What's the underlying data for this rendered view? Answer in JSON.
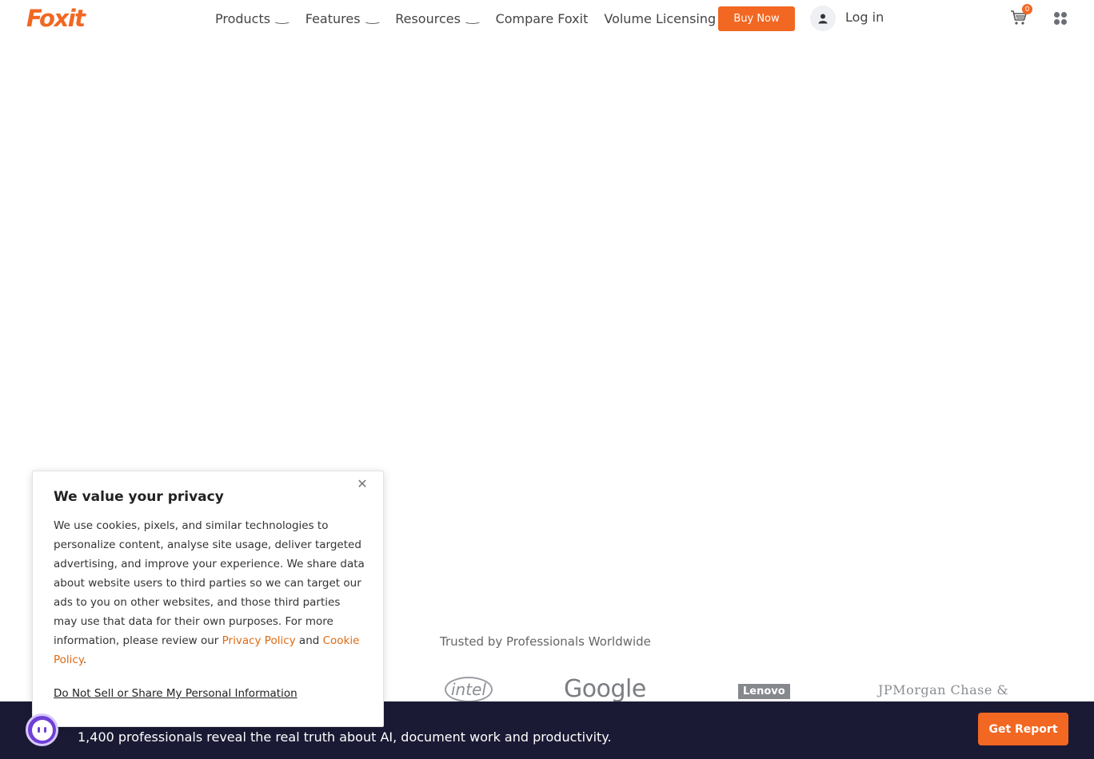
{
  "header": {
    "logo_text": "Foxit",
    "nav": [
      {
        "label": "Products",
        "has_dropdown": true
      },
      {
        "label": "Features",
        "has_dropdown": true
      },
      {
        "label": "Resources",
        "has_dropdown": true
      },
      {
        "label": "Compare Foxit",
        "has_dropdown": false
      },
      {
        "label": "Volume Licensing",
        "has_dropdown": false
      }
    ],
    "buy_label": "Buy Now",
    "login_label": "Log in",
    "cart_count": "0"
  },
  "trusted": {
    "heading": "Trusted by Professionals Worldwide",
    "logos": [
      "intel",
      "Google",
      "Lenovo",
      "JPMorgan Chase &"
    ]
  },
  "banner": {
    "text": "1,400 professionals reveal the real truth about AI, document work and productivity.",
    "button_label": "Get Report"
  },
  "privacy": {
    "title": "We value your privacy",
    "body_prefix": "We use cookies, pixels, and similar technologies to personalize content, analyse site usage, deliver targeted advertising, and improve your experience. We share data about website users to third parties so we can target our ads to you on other websites, and those third parties may use that data for their own purposes. For more information, please review our ",
    "privacy_link": "Privacy Policy",
    "and_text": " and ",
    "cookie_link": "Cookie Policy",
    "period": ".",
    "dns_link": "Do Not Sell or Share My Personal Information",
    "close_icon": "close-icon"
  },
  "colors": {
    "brand_orange": "#f26722",
    "banner_bg": "#1b1a35",
    "chat_purple": "#6e3fd6"
  }
}
